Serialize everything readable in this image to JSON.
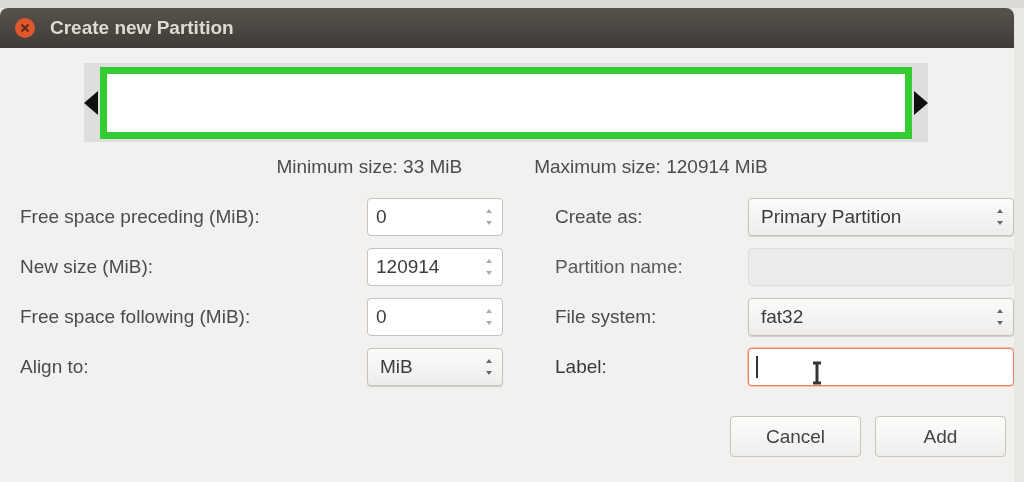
{
  "window": {
    "title": "Create new Partition"
  },
  "size_limits": {
    "minimum": "Minimum size: 33 MiB",
    "maximum": "Maximum size: 120914 MiB"
  },
  "left_fields": [
    {
      "kind": "spin",
      "label": "Free space preceding (MiB):",
      "value": "0"
    },
    {
      "kind": "spin",
      "label": "New size (MiB):",
      "value": "120914"
    },
    {
      "kind": "spin",
      "label": "Free space following (MiB):",
      "value": "0"
    },
    {
      "kind": "combo",
      "label": "Align to:",
      "value": "MiB"
    }
  ],
  "right_fields": [
    {
      "kind": "combo",
      "label": "Create as:",
      "value": "Primary Partition"
    },
    {
      "kind": "entry",
      "label": "Partition name:",
      "disabled": true,
      "focused": false
    },
    {
      "kind": "combo",
      "label": "File system:",
      "value": "fat32"
    },
    {
      "kind": "entry",
      "label": "Label:",
      "disabled": false,
      "focused": true
    }
  ],
  "buttons": [
    "Cancel",
    "Add"
  ]
}
